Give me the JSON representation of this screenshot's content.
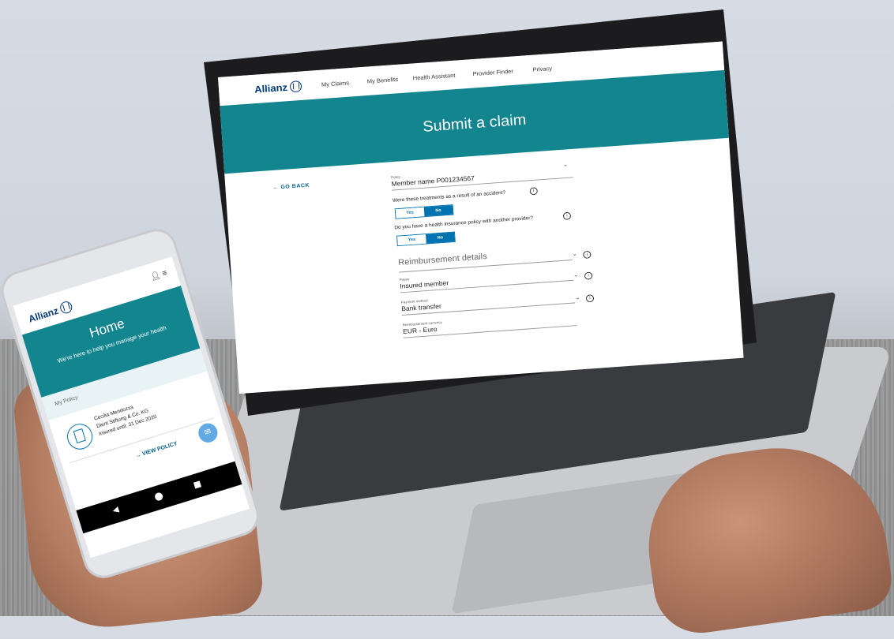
{
  "laptop": {
    "nav": {
      "logo": "Allianz",
      "items": [
        "My Claims",
        "My Benefits",
        "Health Assistant",
        "Provider Finder",
        "Privacy"
      ]
    },
    "hero_title": "Submit a claim",
    "go_back": "← GO BACK",
    "policy": {
      "label": "Policy",
      "value": "Member name P001234567"
    },
    "question_accident": "Were these treatments as a result of an accident?",
    "question_other_policy": "Do you have a health insurance policy with another provider?",
    "toggle_yes": "Yes",
    "toggle_no": "No",
    "reimbursement_heading": "Reimbursement details",
    "payee": {
      "label": "Payee",
      "value": "Insured member"
    },
    "payment_method": {
      "label": "Payment method",
      "value": "Bank transfer"
    },
    "currency": {
      "label": "Reimbursement currency",
      "value": "EUR - Euro"
    }
  },
  "phone": {
    "logo": "Allianz",
    "home_title": "Home",
    "home_subtitle": "We're here to help you manage your health",
    "my_policy": "My Policy",
    "member_name": "Cecilia Mendozza",
    "company": "Dient Stiftung & Co. KG",
    "insured_until": "Insured until: 31 Dec 2020",
    "view_policy": "→ VIEW POLICY"
  },
  "colors": {
    "brand_blue": "#003781",
    "teal": "#13858f",
    "accent_blue": "#0073b0"
  }
}
